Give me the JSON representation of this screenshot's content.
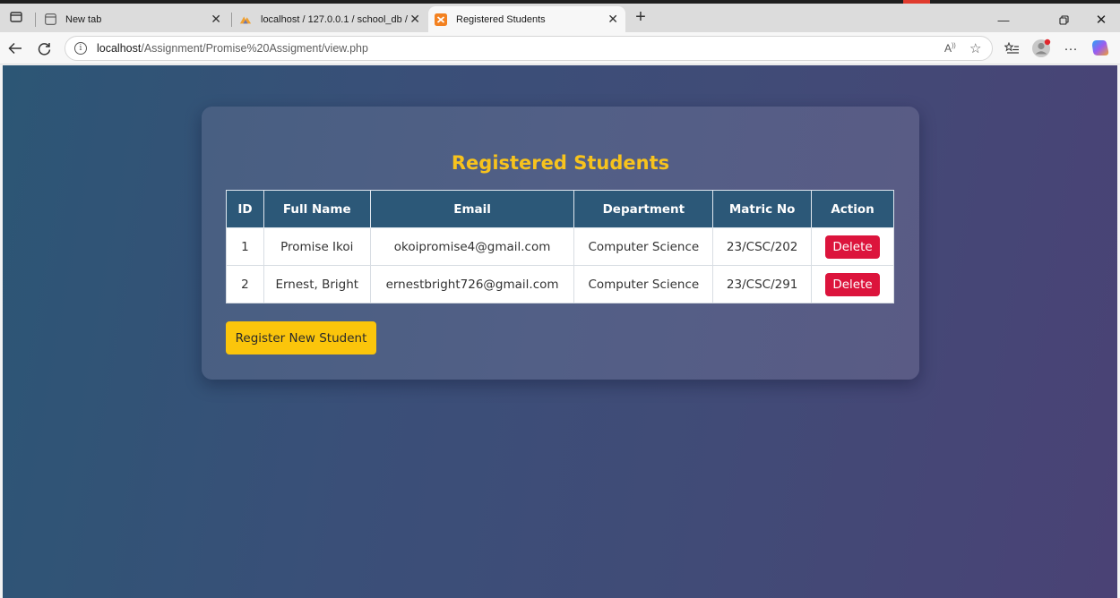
{
  "browser": {
    "tabs": [
      {
        "label": "New tab",
        "favicon": "new-tab-icon"
      },
      {
        "label": "localhost / 127.0.0.1 / school_db /",
        "favicon": "phpmyadmin-icon"
      },
      {
        "label": "Registered Students",
        "favicon": "xampp-icon"
      }
    ],
    "active_tab": 2,
    "url": {
      "host": "localhost",
      "path": "/Assignment/Promise%20Assigment/view.php"
    },
    "toolbar_icons": [
      "read-aloud-icon",
      "favorite-star-icon",
      "favorites-list-icon",
      "profile-avatar-icon",
      "more-options-icon",
      "copilot-icon"
    ]
  },
  "page": {
    "title": "Registered Students",
    "table": {
      "headers": [
        "ID",
        "Full Name",
        "Email",
        "Department",
        "Matric No",
        "Action"
      ],
      "rows": [
        {
          "id": "1",
          "full_name": "Promise Ikoi",
          "email": "okoipromise4@gmail.com",
          "department": "Computer Science",
          "matric_no": "23/CSC/202",
          "action": "Delete"
        },
        {
          "id": "2",
          "full_name": "Ernest, Bright",
          "email": "ernestbright726@gmail.com",
          "department": "Computer Science",
          "matric_no": "23/CSC/291",
          "action": "Delete"
        }
      ]
    },
    "register_button": "Register New Student"
  },
  "colors": {
    "title": "#f7c31d",
    "table_header": "#2c5878",
    "delete_button": "#dc143c",
    "register_button": "#fbc50b"
  }
}
